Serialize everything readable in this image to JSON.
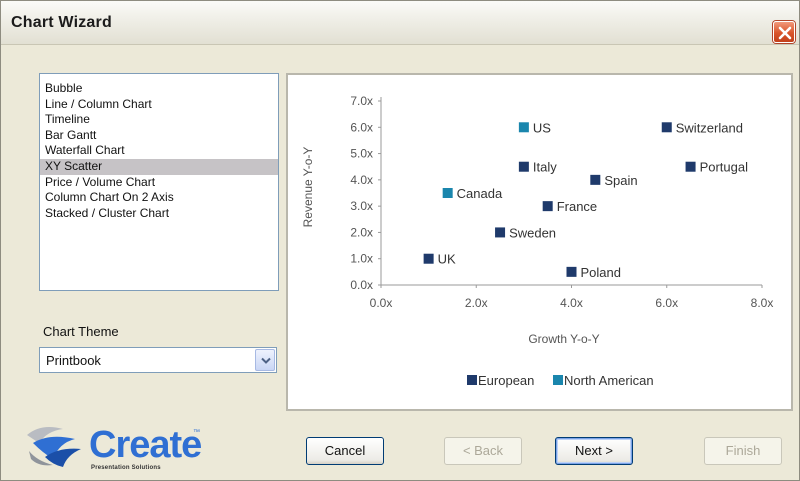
{
  "window": {
    "title": "Chart Wizard",
    "close_icon": "close-icon"
  },
  "chart_types": {
    "items": [
      "Bubble",
      "Line / Column Chart",
      "Timeline",
      "Bar Gantt",
      "Waterfall Chart",
      "XY Scatter",
      "Price / Volume Chart",
      "Column Chart On 2 Axis",
      "Stacked / Cluster Chart"
    ],
    "selected": "XY Scatter"
  },
  "theme": {
    "label": "Chart Theme",
    "value": "Printbook"
  },
  "chart_data": {
    "type": "scatter",
    "title": "",
    "xlabel": "Growth Y-o-Y",
    "ylabel": "Revenue Y-o-Y",
    "xlim": [
      0,
      8
    ],
    "ylim": [
      0,
      7
    ],
    "x_ticks": [
      "0.0x",
      "2.0x",
      "4.0x",
      "6.0x",
      "8.0x"
    ],
    "y_ticks": [
      "0.0x",
      "1.0x",
      "2.0x",
      "3.0x",
      "4.0x",
      "5.0x",
      "6.0x",
      "7.0x"
    ],
    "grid": false,
    "legend_position": "bottom",
    "series": [
      {
        "name": "European",
        "color": "#1f3a6b",
        "points": [
          {
            "label": "Switzerland",
            "x": 6.0,
            "y": 6.0
          },
          {
            "label": "Portugal",
            "x": 6.5,
            "y": 4.5
          },
          {
            "label": "Italy",
            "x": 3.0,
            "y": 4.5
          },
          {
            "label": "Spain",
            "x": 4.5,
            "y": 4.0
          },
          {
            "label": "France",
            "x": 3.5,
            "y": 3.0
          },
          {
            "label": "Sweden",
            "x": 2.5,
            "y": 2.0
          },
          {
            "label": "UK",
            "x": 1.0,
            "y": 1.0
          },
          {
            "label": "Poland",
            "x": 4.0,
            "y": 0.5
          }
        ]
      },
      {
        "name": "North American",
        "color": "#1a86ad",
        "points": [
          {
            "label": "US",
            "x": 3.0,
            "y": 6.0
          },
          {
            "label": "Canada",
            "x": 1.4,
            "y": 3.5
          }
        ]
      }
    ]
  },
  "logo": {
    "word": "Create",
    "tm": "™",
    "subtitle": "Presentation Solutions"
  },
  "buttons": {
    "cancel": "Cancel",
    "back": "< Back",
    "next": "Next >",
    "finish": "Finish"
  }
}
